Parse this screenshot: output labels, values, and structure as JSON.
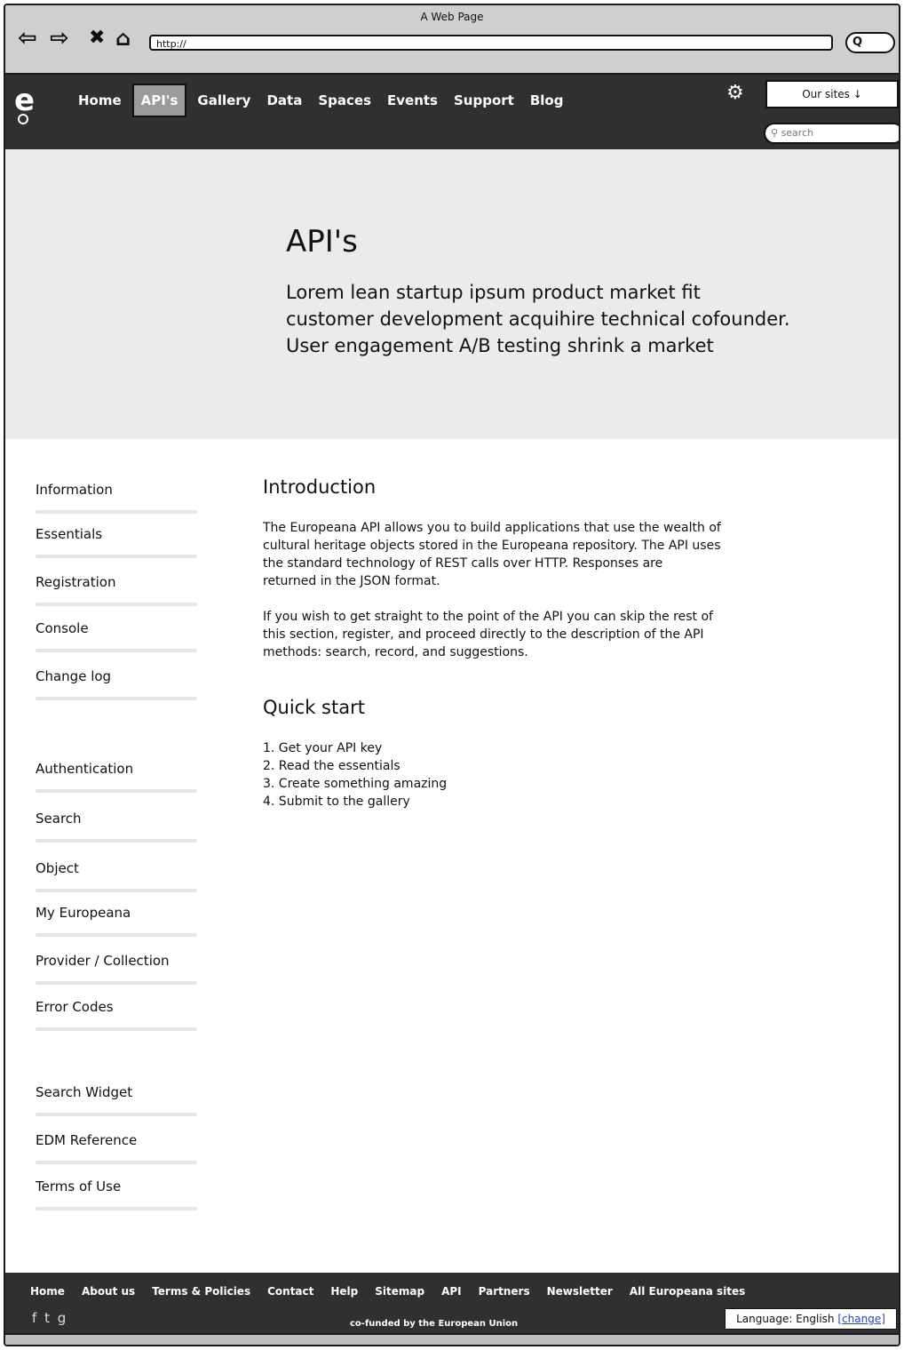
{
  "browser": {
    "window_title": "A Web Page",
    "url": "http://"
  },
  "header": {
    "nav": [
      {
        "label": "Home"
      },
      {
        "label": "API's"
      },
      {
        "label": "Gallery"
      },
      {
        "label": "Data"
      },
      {
        "label": "Spaces"
      },
      {
        "label": "Events"
      },
      {
        "label": "Support"
      },
      {
        "label": "Blog"
      }
    ],
    "active_nav": "API's",
    "our_sites_label": "Our sites ↓",
    "search_placeholder": "search"
  },
  "hero": {
    "title": "API's",
    "subtitle_lines": [
      "Lorem lean startup ipsum product market fit",
      "customer development acquihire technical cofounder.",
      "User engagement A/B testing shrink a market"
    ]
  },
  "sidebar": {
    "groups": [
      [
        "Information",
        "Essentials",
        "Registration",
        "Console",
        "Change log"
      ],
      [
        "Authentication",
        "Search",
        "Object",
        "My Europeana",
        "Provider / Collection",
        "Error Codes"
      ],
      [
        "Search Widget",
        "EDM Reference",
        "Terms of Use"
      ]
    ]
  },
  "content": {
    "intro_heading": "Introduction",
    "intro_p1_lines": [
      "The Europeana API allows you to build applications that use the wealth of",
      "cultural heritage objects stored in the Europeana repository. The API uses",
      "the standard technology of REST calls over HTTP. Responses are",
      "returned in the JSON format."
    ],
    "intro_p2_lines": [
      "If you wish to get straight to the point of the API you can skip the rest of",
      "this section, register, and proceed directly to the description of the API",
      "methods: search, record, and suggestions."
    ],
    "quickstart_heading": "Quick start",
    "quickstart_steps": [
      "1. Get your API key",
      "2. Read the essentials",
      "3. Create something amazing",
      "4. Submit to the gallery"
    ]
  },
  "footer": {
    "links": [
      "Home",
      "About us",
      "Terms & Policies",
      "Contact",
      "Help",
      "Sitemap",
      "API",
      "Partners",
      "Newsletter",
      "All Europeana sites"
    ],
    "social_icons": [
      "facebook-icon",
      "twitter-icon",
      "google-plus-icon"
    ],
    "cofunded": "co-funded by the European Union",
    "language_label": "Language: English",
    "language_change": "[change]"
  }
}
